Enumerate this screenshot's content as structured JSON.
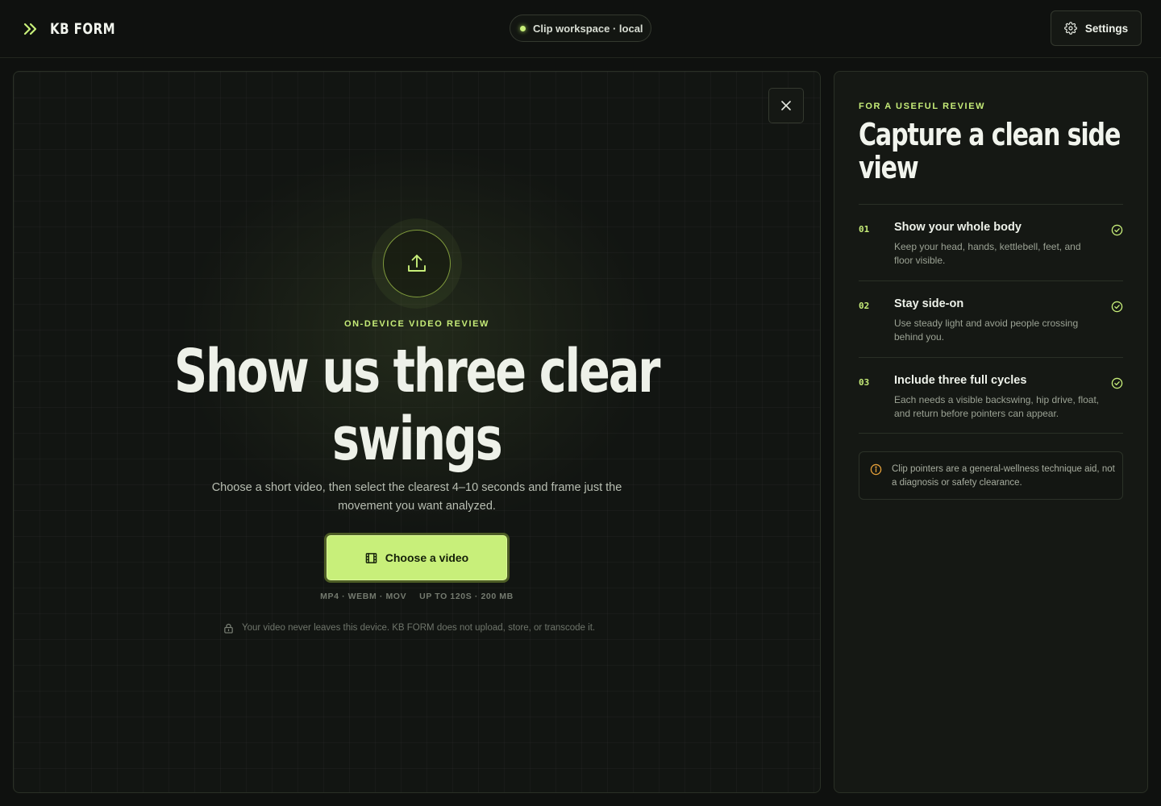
{
  "header": {
    "brand_name": "KB FORM",
    "workspace_status": "Clip workspace · local",
    "settings_label": "Settings"
  },
  "upload": {
    "eyebrow": "ON-DEVICE VIDEO REVIEW",
    "headline_line1": "Show us three clear",
    "headline_line2": "swings",
    "description": "Choose a short video, then select the clearest 4–10 seconds and frame just the movement you want analyzed.",
    "choose_button_label": "Choose a video",
    "formats": "MP4 · WEBM · MOV",
    "limits": "UP TO 120S · 200 MB",
    "privacy_note": "Your video never leaves this device. KB FORM does not upload, store, or transcode it."
  },
  "guide": {
    "eyebrow": "FOR A USEFUL REVIEW",
    "title_line1": "Capture a clean side",
    "title_line2": "view",
    "tips": [
      {
        "number": "01",
        "title": "Show your whole body",
        "body": "Keep your head, hands, kettlebell, feet, and floor visible."
      },
      {
        "number": "02",
        "title": "Stay side-on",
        "body": "Use steady light and avoid people crossing behind you."
      },
      {
        "number": "03",
        "title": "Include three full cycles",
        "body": "Each needs a visible backswing, hip drive, float, and return before pointers can appear."
      }
    ],
    "notice": "Clip pointers are a general-wellness technique aid, not a diagnosis or safety clearance."
  },
  "icons": {
    "brand": "double-chevron-right-icon",
    "settings": "gear-icon",
    "close": "close-icon",
    "upload": "upload-icon",
    "choose": "film-icon",
    "privacy": "lock-icon",
    "tip_status": "check-circle-icon",
    "notice": "info-icon"
  },
  "colors": {
    "accent": "#c8ef7a",
    "background": "#0f110f",
    "panel": "#151814",
    "notice_icon": "#e6a13a"
  }
}
